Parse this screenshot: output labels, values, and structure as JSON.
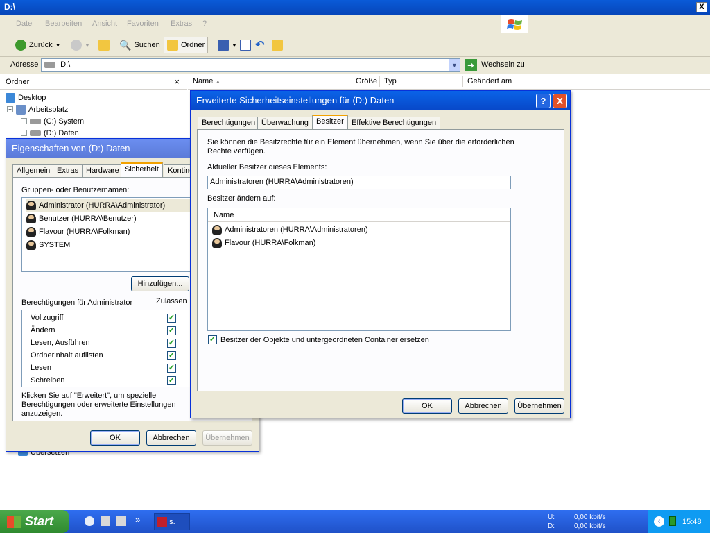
{
  "explorer": {
    "title": "D:\\",
    "close_label": "X",
    "menu": [
      "Datei",
      "Bearbeiten",
      "Ansicht",
      "Favoriten",
      "Extras",
      "?"
    ],
    "toolbar": {
      "back": "Zurück",
      "search": "Suchen",
      "folders": "Ordner"
    },
    "address": {
      "label": "Adresse",
      "value": "D:\\",
      "go": "Wechseln zu"
    },
    "folder_pane": {
      "title": "Ordner",
      "close": "×",
      "items": [
        "Desktop",
        "Arbeitsplatz",
        "(C:) System",
        "(D:) Daten",
        "Übersetzen"
      ]
    },
    "columns": [
      "Name",
      "Größe",
      "Typ",
      "Geändert am"
    ]
  },
  "properties_dialog": {
    "title": "Eigenschaften von (D:) Daten",
    "tabs": [
      "Allgemein",
      "Extras",
      "Hardware",
      "Sicherheit",
      "Konting"
    ],
    "groups_label": "Gruppen- oder Benutzernamen:",
    "users": [
      "Administrator (HURRA\\Administrator)",
      "Benutzer (HURRA\\Benutzer)",
      "Flavour (HURRA\\Folkman)",
      "SYSTEM"
    ],
    "add_button": "Hinzufügen...",
    "perm_label": "Berechtigungen für Administrator",
    "allow_label": "Zulassen",
    "permissions": [
      "Vollzugriff",
      "Ändern",
      "Lesen, Ausführen",
      "Ordnerinhalt auflisten",
      "Lesen",
      "Schreiben"
    ],
    "note": "Klicken Sie auf \"Erweitert\", um spezielle Berechtigungen oder erweiterte Einstellungen anzuzeigen.",
    "ok": "OK",
    "cancel": "Abbrechen",
    "apply": "Übernehmen"
  },
  "advanced_dialog": {
    "title": "Erweiterte Sicherheitseinstellungen für (D:) Daten",
    "help": "?",
    "close": "X",
    "tabs": [
      "Berechtigungen",
      "Überwachung",
      "Besitzer",
      "Effektive Berechtigungen"
    ],
    "description": "Sie können die Besitzrechte für ein Element übernehmen, wenn Sie über die erforderlichen Rechte verfügen.",
    "current_owner_label": "Aktueller Besitzer dieses Elements:",
    "current_owner": "Administratoren (HURRA\\Administratoren)",
    "change_owner_label": "Besitzer ändern auf:",
    "list_header": "Name",
    "owners": [
      "Administratoren (HURRA\\Administratoren)",
      "Flavour (HURRA\\Folkman)"
    ],
    "replace_label": "Besitzer der Objekte und untergeordneten Container ersetzen",
    "ok": "OK",
    "cancel": "Abbrechen",
    "apply": "Übernehmen"
  },
  "taskbar": {
    "start": "Start",
    "chevron": "»",
    "task_label": "s.",
    "net_u": "U:",
    "net_d": "D:",
    "net_u_val": "0,00 kbit/s",
    "net_d_val": "0,00 kbit/s",
    "clock": "15:48"
  }
}
